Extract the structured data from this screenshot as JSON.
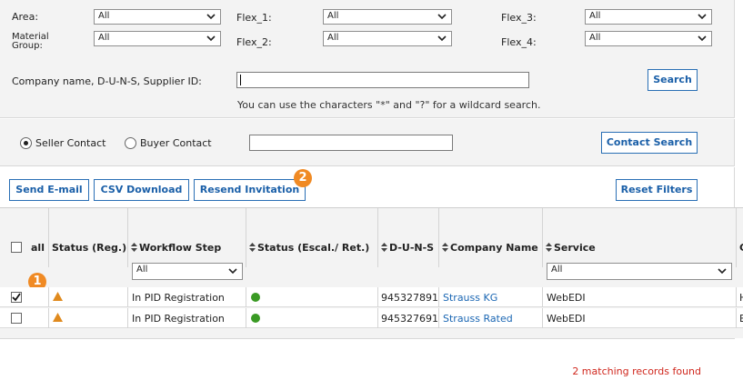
{
  "filters": {
    "area_label": "Area:",
    "area_value": "All",
    "material_group_label_1": "Material",
    "material_group_label_2": "Group:",
    "material_group_value": "All",
    "flex1_label": "Flex_1:",
    "flex1_value": "All",
    "flex2_label": "Flex_2:",
    "flex2_value": "All",
    "flex3_label": "Flex_3:",
    "flex3_value": "All",
    "flex4_label": "Flex_4:",
    "flex4_value": "All",
    "company_label": "Company name, D-U-N-S, Supplier ID:",
    "company_value": "",
    "search_button": "Search",
    "wildcard_hint": "You can use the characters \"*\" and \"?\" for a wildcard search."
  },
  "contact": {
    "seller_label": "Seller Contact",
    "seller_selected": true,
    "buyer_label": "Buyer Contact",
    "buyer_selected": false,
    "contact_value": "",
    "contact_search_button": "Contact Search"
  },
  "actions": {
    "send_email": "Send E-mail",
    "csv_download": "CSV Download",
    "resend_invitation": "Resend Invitation",
    "reset_filters": "Reset Filters",
    "badge_2": "2"
  },
  "grid": {
    "col_all": "all",
    "col_status_reg": "Status (Reg.)",
    "col_workflow": "Workflow Step",
    "col_status_esc": "Status (Escal./ Ret.)",
    "col_duns": "D-U-N-S",
    "col_company": "Company Name",
    "col_service": "Service",
    "col_extra": "C",
    "workflow_filter": "All",
    "service_filter": "All",
    "badge_1": "1",
    "rows": [
      {
        "checked": true,
        "workflow": "In PID Registration",
        "duns": "945327891",
        "company": "Strauss KG",
        "service": "WebEDI",
        "extra": "H"
      },
      {
        "checked": false,
        "workflow": "In PID Registration",
        "duns": "945327691",
        "company": "Strauss Rated",
        "service": "WebEDI",
        "extra": "E"
      }
    ]
  },
  "status": {
    "records_found": "2 matching records found"
  },
  "colors": {
    "accent_blue": "#1a5fa8",
    "badge_orange": "#f08a24",
    "status_green": "#3a9a24",
    "warning_orange": "#e08a1e",
    "records_red": "#d0271d"
  }
}
